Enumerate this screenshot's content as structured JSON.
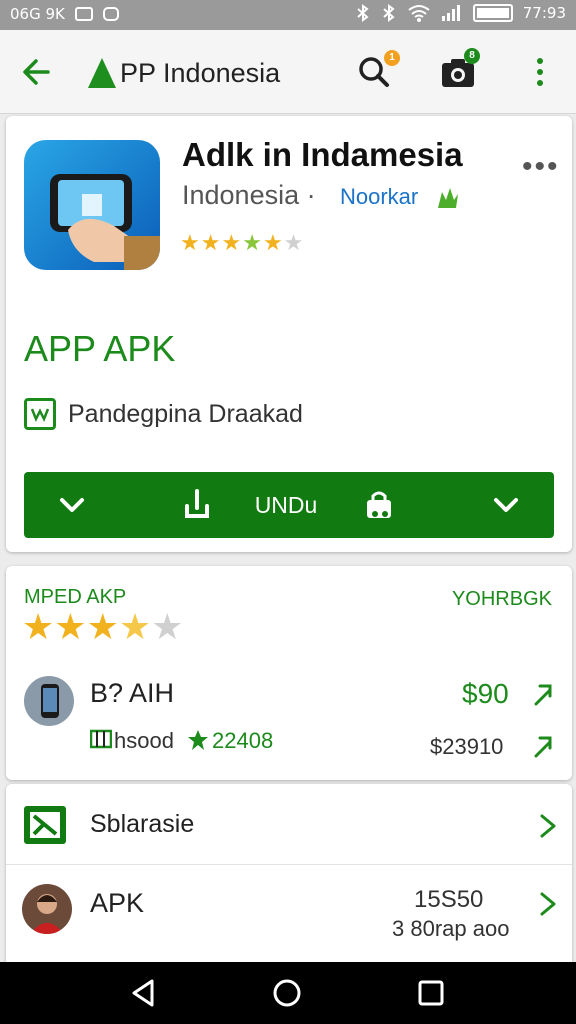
{
  "status_bar": {
    "time_left": "06G 9K",
    "time_right": "77:93"
  },
  "app_bar": {
    "title": "PP Indonesia",
    "search_badge": "1",
    "camera_badge": "8"
  },
  "app_header": {
    "name": "Adlk in Indamesia",
    "subtitle": "Indonesia ·",
    "developer": "Noorkar",
    "rating_stars": 5,
    "rating_filled": 4.5
  },
  "apk_section": {
    "heading": "APP APK",
    "row_label": "Pandegpina Draakad"
  },
  "action_bar": {
    "label": "UNDu"
  },
  "reviews": {
    "title": "MPED AKP",
    "right_label": "YOHRBGK",
    "stars_filled": 3.5,
    "stars_total": 5,
    "item": {
      "title": "B? AIH",
      "price": "$90",
      "sub_left": "hsood",
      "sub_mid": "22408",
      "sub_price": "$23910"
    }
  },
  "list": {
    "item1": {
      "title": "Sblarasie"
    },
    "item2": {
      "title": "APK",
      "value": "15S50",
      "sub": "3 80rap aoo"
    }
  },
  "colors": {
    "accent_green": "#1c8b1c",
    "button_green": "#117a11",
    "star_yellow": "#f2b21f"
  }
}
